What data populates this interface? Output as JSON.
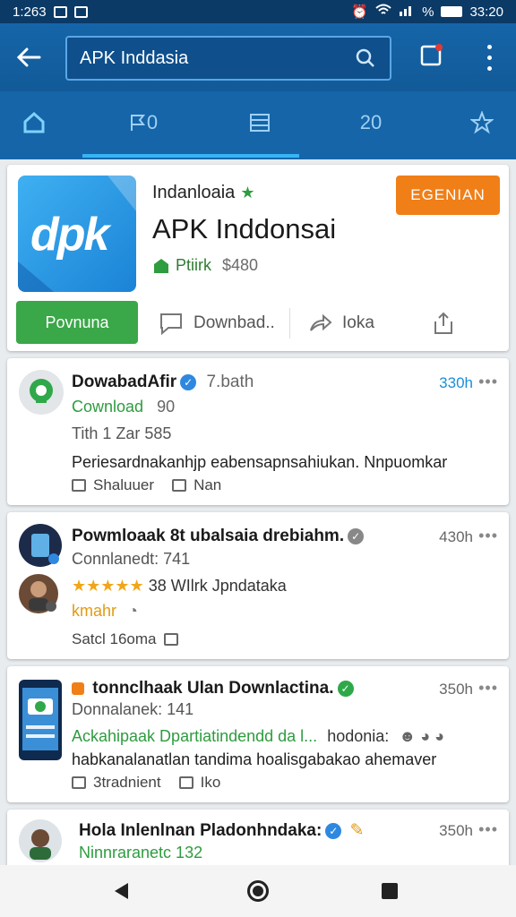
{
  "status_bar": {
    "time": "1:263",
    "percent": "%",
    "clock": "33:20"
  },
  "search": {
    "query": "APK Inddasia"
  },
  "tabs": [
    {
      "label": "",
      "icon": "home-icon"
    },
    {
      "label": "0",
      "icon": "flag-icon"
    },
    {
      "label": "",
      "icon": "grid-icon"
    },
    {
      "label": "20",
      "icon": ""
    },
    {
      "label": "",
      "icon": "star-icon"
    }
  ],
  "app": {
    "logo_text": "dpk",
    "name_small": "Indanloaia",
    "title": "APK Inddonsai",
    "developer": "Ptiirk",
    "price": "$480",
    "badge": "EGENIAN",
    "primary_button": "Povnuna",
    "action_download": "Downbad..",
    "action_share": "Ioka"
  },
  "posts": [
    {
      "title": "DowabadAfir",
      "tag": "7.bath",
      "time": "330h",
      "line1": "Cownload",
      "line1b": "90",
      "line2": "Tith 1 Zar 585",
      "line3": "Periesardnakanhjp eabensapnsahiukan. Nnpuomkar",
      "meta1": "Shaluuer",
      "meta2": "Nan"
    },
    {
      "title": "Powmloaak 8t ubalsaia drebiahm.",
      "time": "430h",
      "line1": "Connlanedt: 741",
      "rating_text": "38 WIlrk Jpndataka",
      "line3": "kmahr",
      "meta1": "Satcl 16oma"
    },
    {
      "title": "tonnclhaak Ulan Downlactina.",
      "time": "350h",
      "line1": "Donnalanek: 141",
      "line2": "Ackahipaak Dpartiatindendd da l...",
      "line2b": "hodonia:",
      "line3": "habkanalanatlan tandima hoalisgabakao ahemaver",
      "meta1": "3tradnient",
      "meta2": "Iko"
    },
    {
      "title": "Hola Inlenlnan Pladonhndaka:",
      "time": "350h",
      "line1": "Ninnraranetc 132"
    }
  ],
  "colors": {
    "appbar": "#1565a8",
    "accent_green": "#3aa748",
    "badge_orange": "#f07f18",
    "link_blue": "#1a8fd6"
  }
}
